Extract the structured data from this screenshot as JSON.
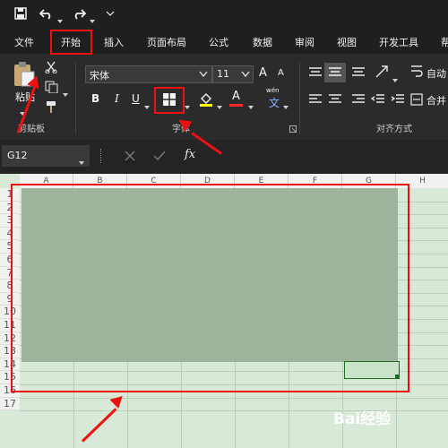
{
  "menu": {
    "file": "文件",
    "home": "开始",
    "insert": "插入",
    "page_layout": "页面布局",
    "formulas": "公式",
    "data": "数据",
    "review": "审阅",
    "view": "视图",
    "developer": "开发工具",
    "overflow": "帮"
  },
  "ribbon": {
    "paste_label": "粘贴",
    "clipboard_group": "剪贴板",
    "font_name": "宋体",
    "font_size": "11",
    "bold": "B",
    "italic": "I",
    "underline": "U",
    "font_group": "字体",
    "alignment_group": "对齐方式",
    "phonetic_top": "wén",
    "phonetic_bottom": "文",
    "auto_label": "自动",
    "merge_label": "合并",
    "font_color_letter": "A",
    "grow_a": "A",
    "shrink_a": "A"
  },
  "formula_bar": {
    "name_box": "G12",
    "fx": "fx"
  },
  "sheet": {
    "columns": [
      "A",
      "B",
      "C",
      "D",
      "E",
      "F",
      "G",
      "H"
    ],
    "rows": [
      "1",
      "2",
      "3",
      "4",
      "5",
      "6",
      "7",
      "8",
      "9",
      "10",
      "11",
      "12",
      "13",
      "14",
      "15",
      "16",
      "17"
    ]
  },
  "watermark": "Bai经验",
  "colors": {
    "accent_red": "#e11111",
    "sheet_fill": "#d8ead7",
    "selection_fill": "#9fb49d"
  }
}
